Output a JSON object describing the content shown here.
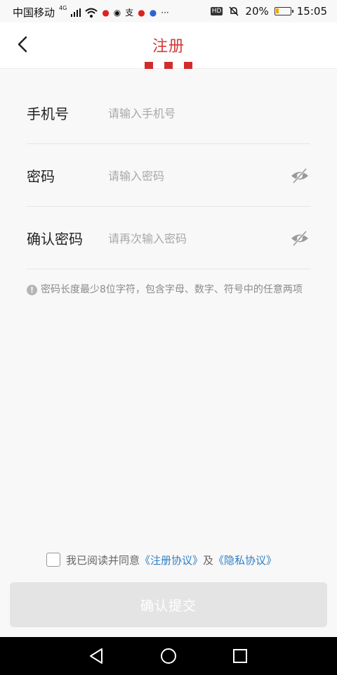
{
  "status_bar": {
    "carrier": "中国移动",
    "network": "4G",
    "battery": "20%",
    "battery_level": 0.2,
    "time": "15:05",
    "hd": "HD"
  },
  "header": {
    "title": "注册"
  },
  "form": {
    "phone": {
      "label": "手机号",
      "placeholder": "请输入手机号",
      "value": ""
    },
    "password": {
      "label": "密码",
      "placeholder": "请输入密码",
      "value": ""
    },
    "confirm": {
      "label": "确认密码",
      "placeholder": "请再次输入密码",
      "value": ""
    }
  },
  "hint": "密码长度最少8位字符，包含字母、数字、符号中的任意两项",
  "agreement": {
    "prefix": "我已阅读并同意",
    "terms_link": "《注册协议》",
    "and": "及",
    "privacy_link": "《隐私协议》",
    "checked": false
  },
  "submit_label": "确认提交",
  "colors": {
    "accent": "#d33a3a",
    "link": "#2f7fc5",
    "disabled_button": "#e4e4e4"
  }
}
